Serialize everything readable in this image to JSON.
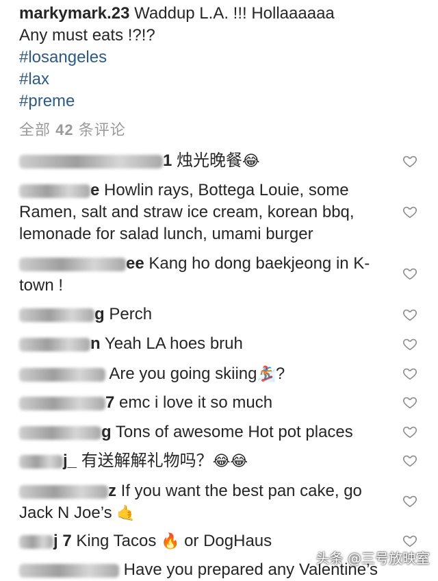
{
  "post": {
    "username": "markymark.23",
    "caption_line1": "Waddup L.A. !!! Hollaaaaaa",
    "caption_line2": "Any must eats !?!?",
    "hashtags": [
      "#losangeles",
      "#lax",
      "#preme"
    ]
  },
  "comments_header": {
    "prefix": "全部",
    "count": "42",
    "suffix": "条评论"
  },
  "comments": [
    {
      "username_visible": "1",
      "text": "烛光晚餐",
      "emoji": "😂"
    },
    {
      "username_visible": "e",
      "text": "Howlin rays, Bottega Louie, some Ramen, salt and straw ice cream, korean bbq, lemonade for salad lunch, umami burger",
      "emoji": ""
    },
    {
      "username_visible": "ee",
      "text": "Kang ho dong baekjeong in K-town !",
      "emoji": ""
    },
    {
      "username_visible": "g",
      "text": "Perch",
      "emoji": ""
    },
    {
      "username_visible": "n",
      "text": "Yeah LA hoes bruh",
      "emoji": ""
    },
    {
      "username_visible": "",
      "text": "Are you going skiing",
      "emoji": "🏂",
      "suffix": "?"
    },
    {
      "username_visible": "7",
      "text": "emc i love it so much",
      "emoji": ""
    },
    {
      "username_visible": "g",
      "text": "Tons of awesome Hot pot places",
      "emoji": ""
    },
    {
      "username_visible": "j_",
      "text": "有送解解礼物吗？",
      "emoji": "😂😂"
    },
    {
      "username_visible": "z",
      "text": "If you want the best pan cake, go Jack N Joe’s",
      "emoji": "🤙"
    },
    {
      "username_visible": "j 7",
      "text": "King Tacos",
      "emoji": "🔥",
      "suffix": " or DogHaus"
    },
    {
      "username_visible": "",
      "text": "Have you prepared any Valentine’s",
      "emoji": ""
    }
  ],
  "watermark": "头条 @三号放映室"
}
